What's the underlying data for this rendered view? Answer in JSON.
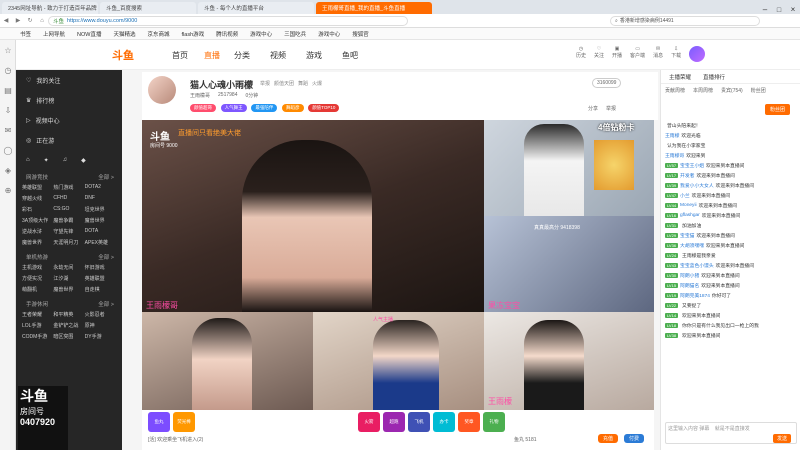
{
  "tabs": [
    {
      "label": "2345网址导航 - 致力于打造百年品牌"
    },
    {
      "label": "斗鱼_百度搜索"
    },
    {
      "label": "斗鱼 - 每个人的直播平台"
    },
    {
      "label": "王雨檬哥直播_我的直播_斗鱼直播"
    }
  ],
  "address": {
    "secure_text": "斗鱼",
    "url": "https://www.douyu.com/9000",
    "search_hint": "香港新增感染病例14491"
  },
  "bookmarks": [
    "书签",
    "上网导航",
    "NOW直播",
    "天猫精选",
    "京东商城",
    "flash游戏",
    "腾讯视频",
    "游戏中心",
    "三国吃兵",
    "游戏中心",
    "搜狐官"
  ],
  "topnav": {
    "logo": "斗鱼",
    "items": [
      "首页",
      "直播",
      "分类",
      "视频",
      "游戏",
      "鱼吧"
    ],
    "right_icons": [
      "历史",
      "关注",
      "开播",
      "客户端",
      "消息",
      "下载"
    ]
  },
  "sidebar": {
    "items": [
      "我的关注",
      "排行榜",
      "视频中心",
      "正在游"
    ],
    "sections": [
      {
        "title": "网游竞技",
        "more": "全部 >",
        "games": [
          "英雄联盟",
          "热门游戏",
          "DOTA2",
          "穿越火线",
          "CFHD",
          "DNF",
          "彩石",
          "CS:GO",
          "坦克世界",
          "3A顶级大作",
          "魔兽争霸",
          "魔兽世界",
          "逆战水浒",
          "守望先锋",
          "DOTA",
          "魔兽世界",
          "天涯明月刀",
          "APEX英雄"
        ]
      },
      {
        "title": "单机热游",
        "more": "全部 >",
        "games": [
          "主机游戏",
          "永劫无间",
          "怀旧游戏",
          "方便实况",
          "江汐湖",
          "英雄联盟",
          "萌翻机",
          "魔兽世界",
          "自走棋"
        ]
      },
      {
        "title": "手游休闲",
        "more": "全部 >",
        "games": [
          "王者荣耀",
          "和平精英",
          "火影忍者",
          "LOL手游",
          "金铲铲之战",
          "原神",
          "CODM手游",
          "暗区突围",
          "DY手游"
        ]
      }
    ],
    "watermark_top": "斗鱼",
    "watermark_sub": "房间号",
    "room_no": "0407920"
  },
  "room": {
    "title": "猫人心魂小雨檬",
    "sub_labels": [
      "举报",
      "颜值天团",
      "舞蹈",
      "火爆"
    ],
    "anchor": "王雨檬哥",
    "hot": "2517984",
    "rank": "0分钟",
    "tags": [
      "颜值超哥",
      "人气舞王",
      "最强陪伴",
      "舞蹈彦",
      "颜值TOP10"
    ],
    "room_id": "3160099",
    "share": "分享",
    "report": "举报",
    "more": "客户端"
  },
  "video": {
    "overlay_main": "直播间只看绝美大佬",
    "cell_labels": [
      "4倍钻粉卡",
      "王雨檬哥",
      "果冻宝宝",
      "人气主播",
      "王雨檬"
    ],
    "room_label": "房间号 9000",
    "mini_text": "真真最高分 9418398"
  },
  "bottombar": {
    "gifts": [
      "鱼丸",
      "荧光棒",
      "火箭",
      "超跑",
      "飞机",
      "办卡",
      "奖章",
      "礼物"
    ],
    "balance": "鱼丸 5181",
    "recharge": "充值",
    "pay": "付费",
    "notice": "[活] 欢迎乘坐飞机进入(2)"
  },
  "chat": {
    "tabs": [
      "主播荣耀",
      "直播排行"
    ],
    "subtabs": [
      "贡献周榜",
      "本周周榜",
      "贵宾(754)",
      "粉丝团"
    ],
    "follow_btn": "粉丝团",
    "lines": [
      {
        "lvl": "",
        "nick": "",
        "msg": "曾山头陪来起！"
      },
      {
        "lvl": "",
        "nick": "王雨檬",
        "msg": "欢迎光临"
      },
      {
        "lvl": "",
        "nick": "",
        "msg": "认为我在小李家宝"
      },
      {
        "lvl": "",
        "nick": "王雨檬哥",
        "msg": "欢迎来到"
      },
      {
        "lvl": "LV57",
        "nick": "宝宝王小姐",
        "msg": "欢迎来到本直播间"
      },
      {
        "lvl": "LV17",
        "nick": "开发者",
        "msg": "欢迎来到本直播间"
      },
      {
        "lvl": "LV39",
        "nick": "我爱小小大女人",
        "msg": "欢迎来到本直播间"
      },
      {
        "lvl": "LV47",
        "nick": "小兰",
        "msg": "欢迎来到本直播间"
      },
      {
        "lvl": "LV44",
        "nick": "Moneyii",
        "msg": "欢迎来到本直播间"
      },
      {
        "lvl": "LV16",
        "nick": "gflashgar",
        "msg": "欢迎来到本直播间"
      },
      {
        "lvl": "LV31",
        "nick": "",
        "msg": "加油加油"
      },
      {
        "lvl": "LV29",
        "nick": "宝宝猫",
        "msg": "欢迎来到本直播间"
      },
      {
        "lvl": "LV36",
        "nick": "大胡须嘿嘿",
        "msg": "欢迎来到本直播间"
      },
      {
        "lvl": "LV24",
        "nick": "",
        "msg": "王雨檬是我亲爱"
      },
      {
        "lvl": "LV43",
        "nick": "宝宝蓝色小馒头",
        "msg": "欢迎来到本直播间"
      },
      {
        "lvl": "LV30",
        "nick": "阿朗小猪",
        "msg": "欢迎来到本直播间"
      },
      {
        "lvl": "LV15",
        "nick": "阿朗猫名",
        "msg": "欢迎来到本直播间"
      },
      {
        "lvl": "LV19",
        "nick": "阿朗完美1874",
        "msg": "你好可了"
      },
      {
        "lvl": "LV22",
        "nick": "",
        "msg": "又要捉了"
      },
      {
        "lvl": "LV14",
        "nick": "",
        "msg": "欢迎来到本直播间"
      },
      {
        "lvl": "LV18",
        "nick": "",
        "msg": "你你只是有什么我见出口一枪上的我"
      },
      {
        "lvl": "LV38",
        "nick": "",
        "msg": "欢迎来到本直播间"
      }
    ],
    "input_placeholder": "这里输入内容 弹幕",
    "send": "发送",
    "extra_hint": "就是不是直接发"
  },
  "colors": {
    "accent": "#ff6b00",
    "sidebar": "#262626",
    "link": "#2b7bd6"
  }
}
